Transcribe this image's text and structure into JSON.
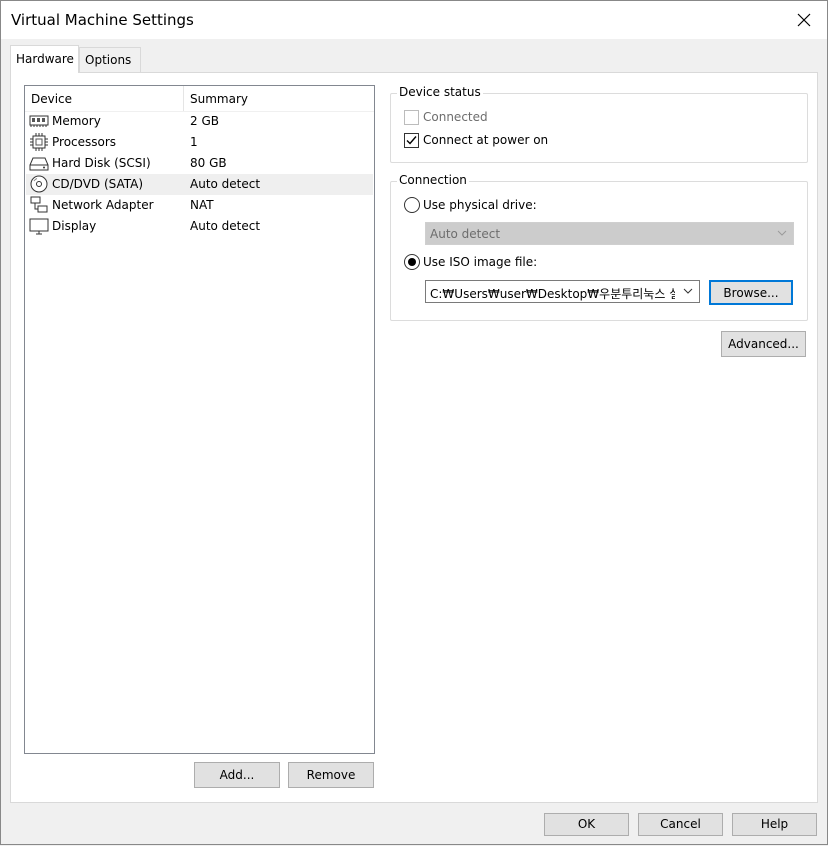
{
  "window": {
    "title": "Virtual Machine Settings"
  },
  "tabs": [
    {
      "label": "Hardware",
      "active": true
    },
    {
      "label": "Options",
      "active": false
    }
  ],
  "device_list": {
    "columns": {
      "device": "Device",
      "summary": "Summary"
    },
    "rows": [
      {
        "icon": "memory-icon",
        "device": "Memory",
        "summary": "2 GB"
      },
      {
        "icon": "processor-icon",
        "device": "Processors",
        "summary": "1"
      },
      {
        "icon": "hard-disk-icon",
        "device": "Hard Disk (SCSI)",
        "summary": "80 GB"
      },
      {
        "icon": "cd-dvd-icon",
        "device": "CD/DVD (SATA)",
        "summary": "Auto detect",
        "selected": true
      },
      {
        "icon": "network-adapter-icon",
        "device": "Network Adapter",
        "summary": "NAT"
      },
      {
        "icon": "display-icon",
        "device": "Display",
        "summary": "Auto detect"
      }
    ],
    "add_label": "Add...",
    "remove_label": "Remove"
  },
  "device_status": {
    "title": "Device status",
    "connected_label": "Connected",
    "connected_checked": false,
    "connected_enabled": false,
    "connect_power_label": "Connect at power on",
    "connect_power_checked": true
  },
  "connection": {
    "title": "Connection",
    "physical_label": "Use physical drive:",
    "physical_value": "Auto detect",
    "iso_label": "Use ISO image file:",
    "iso_value": "C:₩Users₩user₩Desktop₩우분투리눅스 설",
    "browse_label": "Browse...",
    "selected": "iso"
  },
  "advanced_label": "Advanced...",
  "footer": {
    "ok_label": "OK",
    "cancel_label": "Cancel",
    "help_label": "Help"
  }
}
